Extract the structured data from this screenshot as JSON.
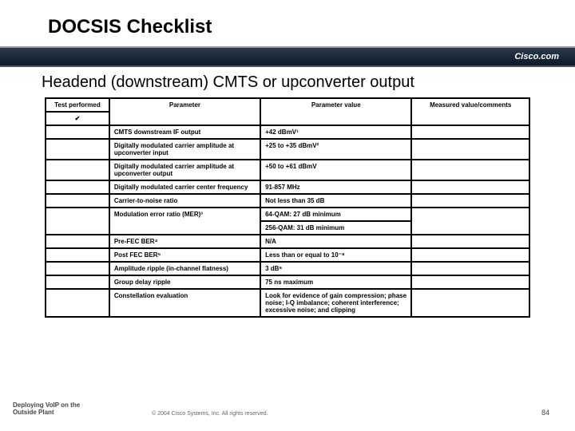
{
  "title": "DOCSIS Checklist",
  "brand": "Cisco.com",
  "subtitle": "Headend (downstream) CMTS or upconverter output",
  "headers": {
    "c1": "Test performed",
    "check": "✔",
    "c2": "Parameter",
    "c3": "Parameter value",
    "c4": "Measured value/comments"
  },
  "rows": [
    {
      "param": "CMTS downstream IF output",
      "value": "+42 dBmV¹",
      "sup1": ""
    },
    {
      "param": "Digitally modulated carrier amplitude at upconverter input",
      "value": "+25 to +35 dBmV²"
    },
    {
      "param": "Digitally modulated carrier amplitude at upconverter output",
      "value": "+50 to +61 dBmV"
    },
    {
      "param": "Digitally modulated carrier center frequency",
      "value": "91-857 MHz"
    },
    {
      "param": "Carrier-to-noise ratio",
      "value": "Not less than 35 dB"
    },
    {
      "param": "Modulation error ratio (MER)³",
      "value": "64-QAM: 27 dB minimum",
      "value2": "256-QAM: 31 dB minimum"
    },
    {
      "param": "Pre-FEC BER⁴",
      "value": "N/A"
    },
    {
      "param": "Post FEC BER⁵",
      "value": "Less than or equal to 10⁻⁸"
    },
    {
      "param": "Amplitude ripple (in-channel flatness)",
      "value": "3 dB⁶"
    },
    {
      "param": "Group delay ripple",
      "value": "75 ns maximum"
    },
    {
      "param": "Constellation evaluation",
      "value": "Look for evidence of gain compression; phase noise; I-Q imbalance; coherent interference; excessive noise; and clipping"
    }
  ],
  "footer": {
    "left1": "Deploying VoIP on the",
    "left2": "Outside Plant",
    "center": "© 2004 Cisco Systems, Inc. All rights reserved.",
    "right": "84"
  }
}
